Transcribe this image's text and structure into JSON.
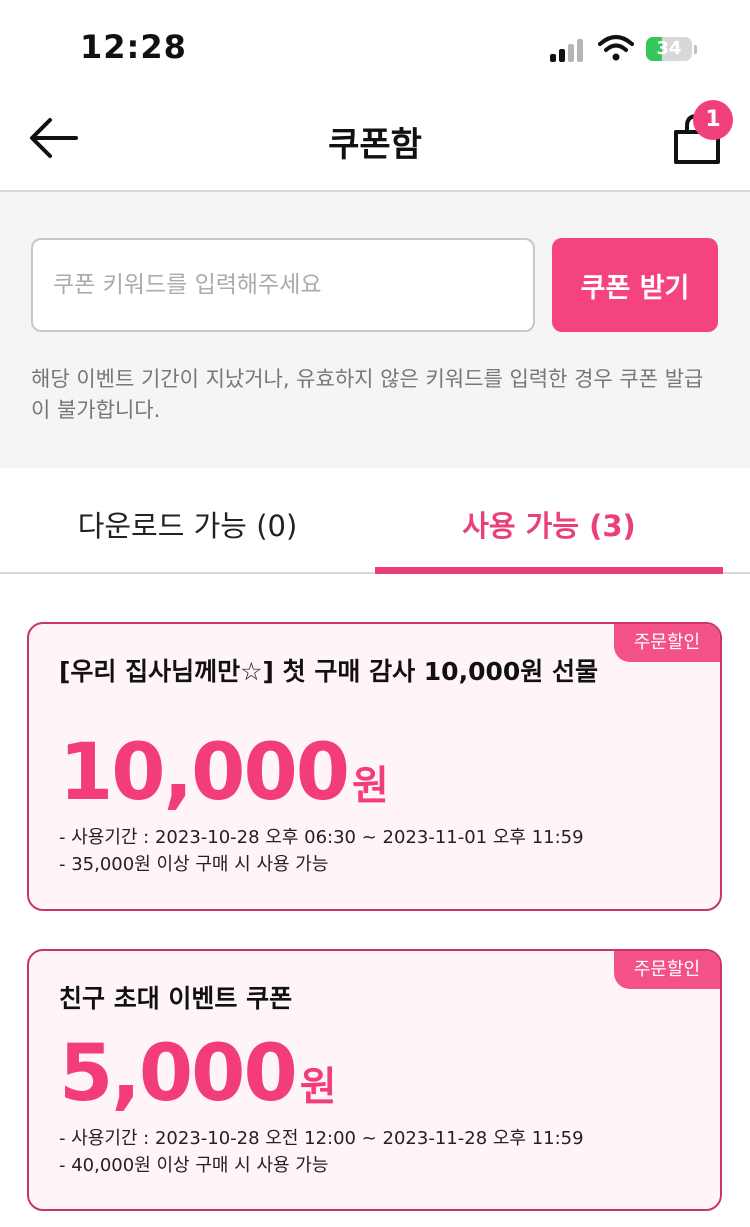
{
  "status_bar": {
    "time": "12:28",
    "battery": "34"
  },
  "header": {
    "title": "쿠폰함",
    "cart_count": "1"
  },
  "coupon_form": {
    "placeholder": "쿠폰 키워드를 입력해주세요",
    "button_label": "쿠폰 받기",
    "notice": "해당 이벤트 기간이 지났거나, 유효하지 않은 키워드를 입력한 경우 쿠폰 발급이 불가합니다."
  },
  "tabs": [
    {
      "label": "다운로드 가능 (0)"
    },
    {
      "label": "사용 가능 (3)"
    }
  ],
  "coupons": [
    {
      "badge": "주문할인",
      "title": "[우리 집사님께만☆] 첫 구매 감사 10,000원 선물",
      "amount": "10,000",
      "unit": "원",
      "period": "- 사용기간 : 2023-10-28 오후 06:30 ~ 2023-11-01 오후 11:59",
      "condition": "- 35,000원 이상 구매 시 사용 가능"
    },
    {
      "badge": "주문할인",
      "title": "친구 초대 이벤트 쿠폰",
      "amount": "5,000",
      "unit": "원",
      "period": "- 사용기간 : 2023-10-28 오전 12:00 ~ 2023-11-28 오후 11:59",
      "condition": "- 40,000원 이상 구매 시 사용 가능"
    }
  ]
}
